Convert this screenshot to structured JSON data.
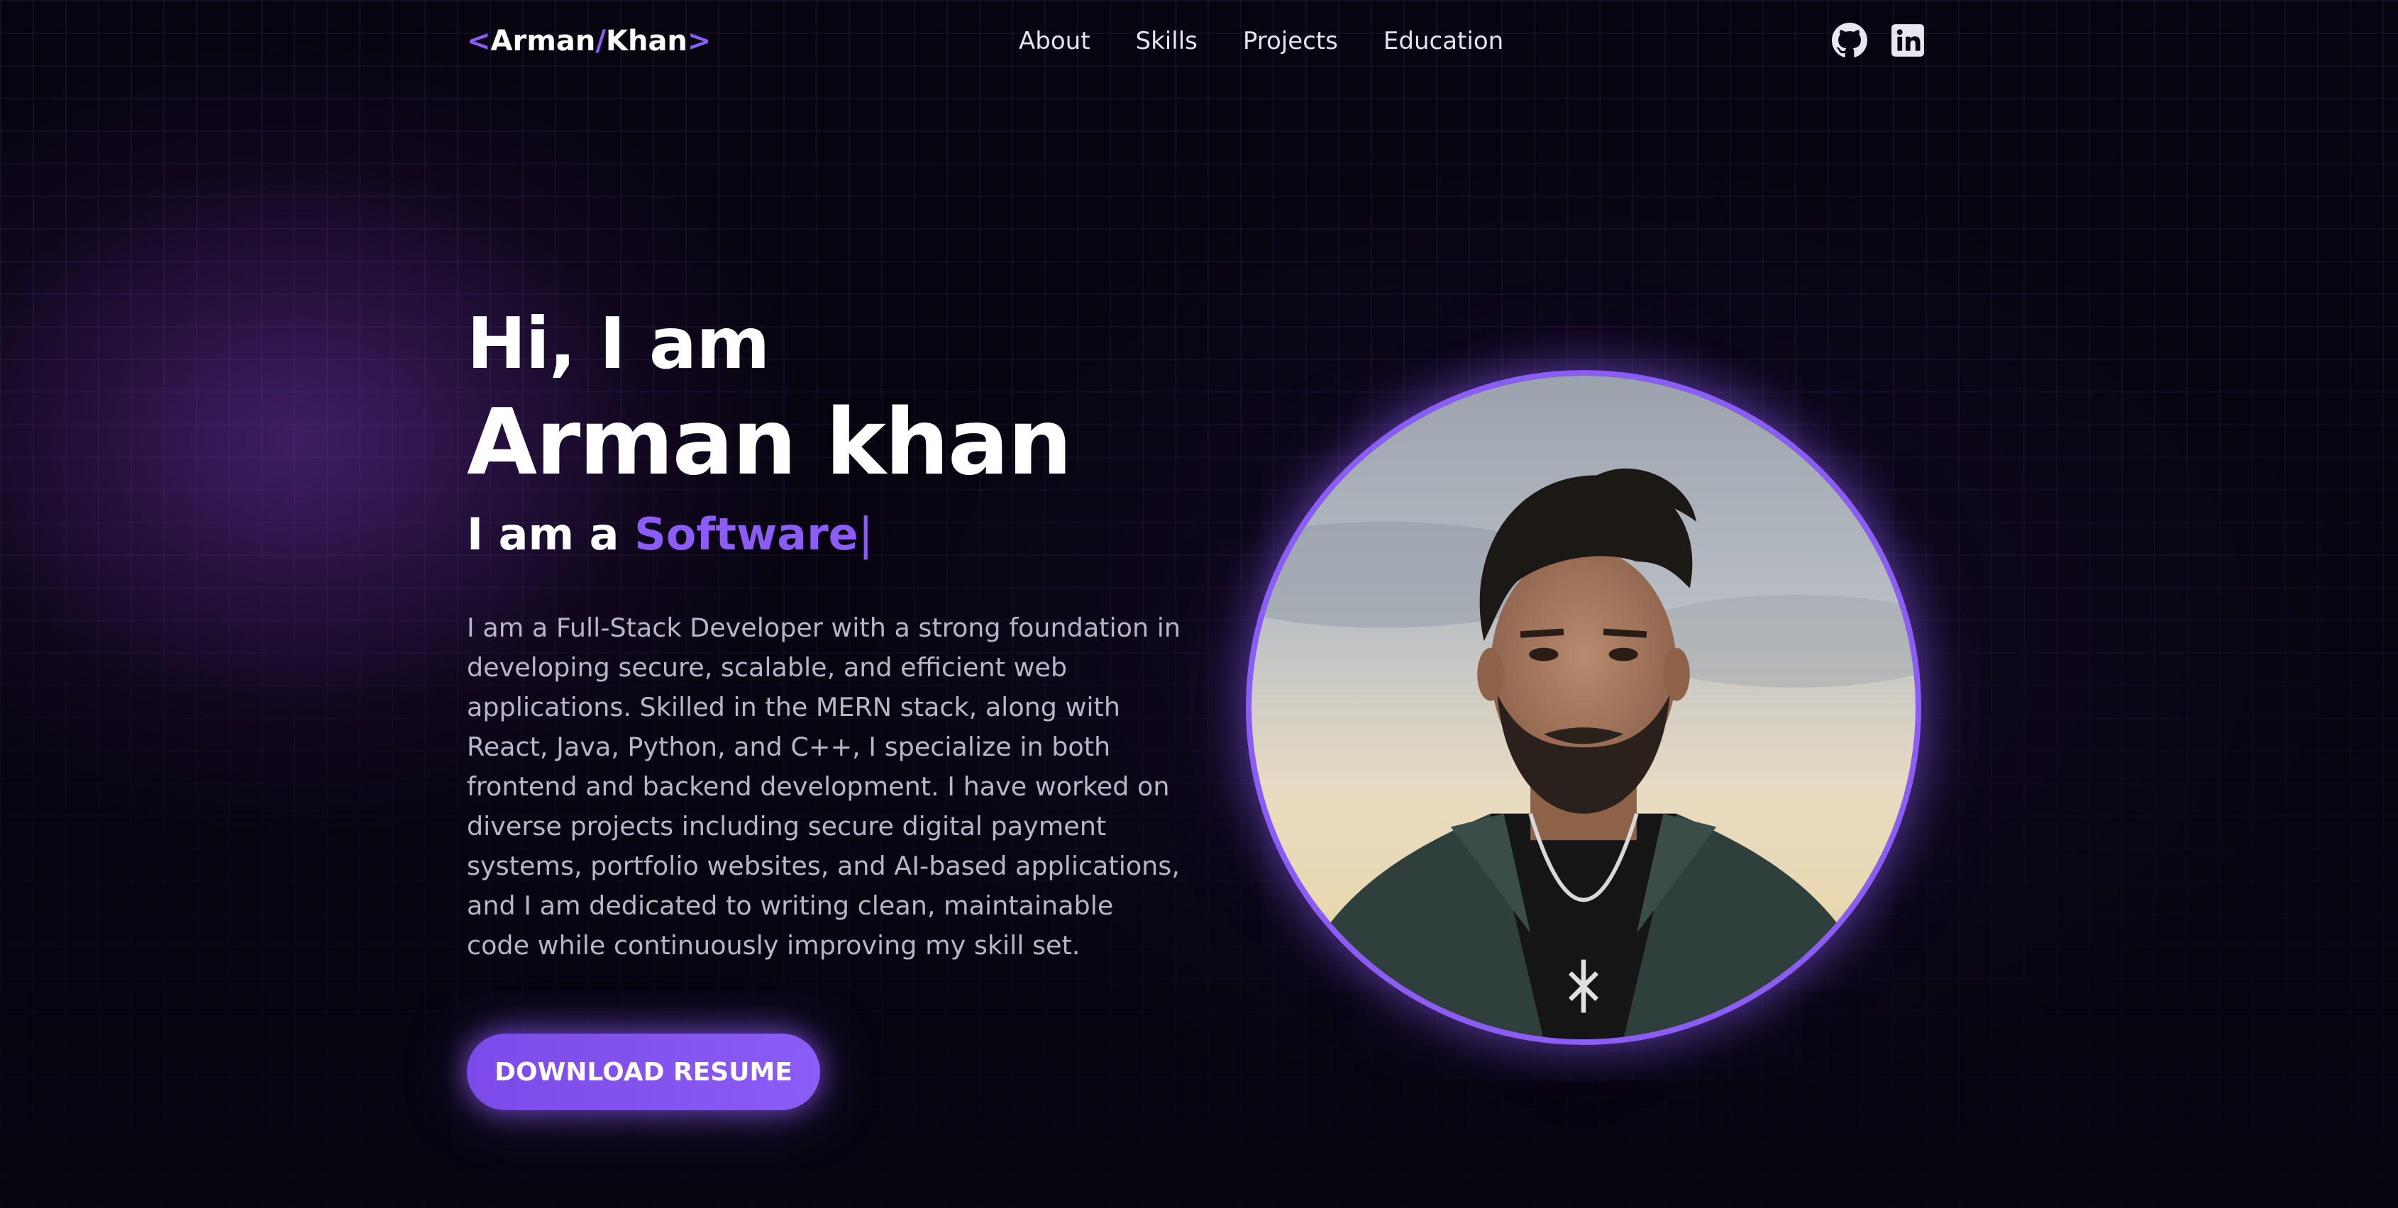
{
  "nav": {
    "logo": {
      "open": "<",
      "first": "Arman",
      "slash": "/",
      "last": "Khan",
      "close": ">"
    },
    "links": [
      "About",
      "Skills",
      "Projects",
      "Education"
    ],
    "social": [
      {
        "icon": "github-icon"
      },
      {
        "icon": "linkedin-icon"
      }
    ]
  },
  "hero": {
    "greeting": "Hi, I am",
    "name": "Arman khan",
    "role_prefix": "I am a ",
    "role_typed": "Software",
    "cursor": "|",
    "bio": "I am a Full-Stack Developer with a strong foundation in developing secure, scalable, and efficient web applications. Skilled in the MERN stack, along with React, Java, Python, and C++, I specialize in both frontend and backend development. I have worked on diverse projects including secure digital payment systems, portfolio websites, and AI-based applications, and I am dedicated to writing clean, maintainable code while continuously improving my skill set.",
    "button_label": "DOWNLOAD RESUME"
  },
  "colors": {
    "accent": "#8b5cf6",
    "background": "#07040f",
    "text": "#ffffff",
    "muted_text": "#b9b5c7"
  }
}
